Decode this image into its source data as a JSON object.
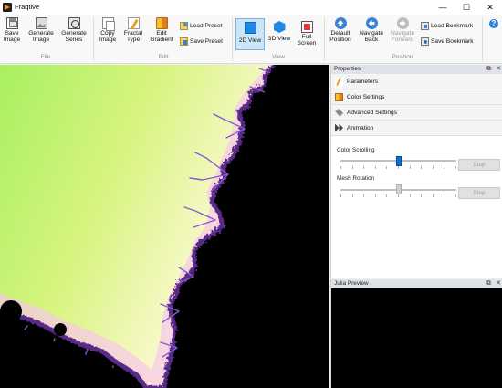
{
  "window": {
    "title": "Fraqtive",
    "minimize": "—",
    "maximize": "☐",
    "close": "✕"
  },
  "ribbon": {
    "file": {
      "save_image": [
        "Save",
        "Image"
      ],
      "generate_image": [
        "Generate",
        "Image"
      ],
      "generate_series": [
        "Generate",
        "Series"
      ],
      "group_label": "File"
    },
    "edit": {
      "copy_image": [
        "Copy",
        "Image"
      ],
      "fractal_type": [
        "Fractal",
        "Type"
      ],
      "edit_gradient": [
        "Edit",
        "Gradient"
      ],
      "load_preset": "Load Preset",
      "save_preset": "Save Preset",
      "group_label": "Edit"
    },
    "view": {
      "view_2d": "2D View",
      "view_3d": "3D View",
      "full_screen": [
        "Full",
        "Screen"
      ],
      "group_label": "View"
    },
    "position": {
      "default_position": [
        "Default",
        "Position"
      ],
      "navigate_back": [
        "Navigate",
        "Back"
      ],
      "navigate_forward": [
        "Navigate",
        "Forward"
      ],
      "load_bookmark": "Load Bookmark",
      "save_bookmark": "Save Bookmark",
      "group_label": "Position"
    },
    "help": "?"
  },
  "properties": {
    "title": "Properties",
    "sections": [
      "Parameters",
      "Color Settings",
      "Advanced Settings",
      "Animation"
    ],
    "animation": {
      "color_scrolling_label": "Color Scrolling",
      "color_scrolling_value": 0.5,
      "color_scrolling_stop": "Stop",
      "mesh_rotation_label": "Mesh Rotation",
      "mesh_rotation_value": 0.5,
      "mesh_rotation_stop": "Stop"
    }
  },
  "julia_preview": {
    "title": "Julia Preview"
  },
  "colors": {
    "fractal_outside_bright": "#a8f060",
    "fractal_outside_pale": "#f4f8c8",
    "fractal_edge_pink": "#f6c8e8",
    "fractal_edge_purple": "#5a2a8a",
    "fractal_inside": "#000000",
    "accent": "#0a6fd3"
  }
}
